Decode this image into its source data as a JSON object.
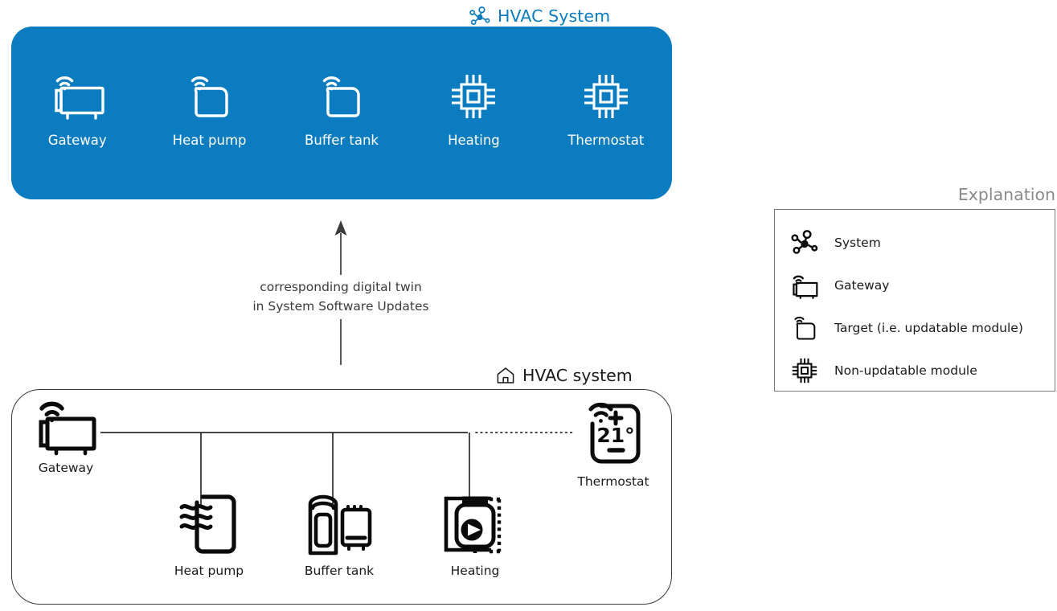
{
  "digital_twin": {
    "title": "HVAC System",
    "title_icon": "system-network-icon",
    "panel_color": "#0b7cbf",
    "title_color": "#0b7cbf",
    "nodes": [
      {
        "label": "Gateway",
        "icon": "gateway-icon"
      },
      {
        "label": "Heat pump",
        "icon": "target-module-icon"
      },
      {
        "label": "Buffer tank",
        "icon": "target-module-icon"
      },
      {
        "label": "Heating",
        "icon": "chip-icon"
      },
      {
        "label": "Thermostat",
        "icon": "chip-icon"
      }
    ]
  },
  "link": {
    "caption_line1": "corresponding digital twin",
    "caption_line2": "in System Software Updates",
    "arrow_direction": "up"
  },
  "physical_system": {
    "title": "HVAC system",
    "title_icon": "house-icon",
    "devices": [
      {
        "label": "Gateway",
        "icon": "gateway-icon"
      },
      {
        "label": "Heat pump",
        "icon": "heat-pump-icon"
      },
      {
        "label": "Buffer tank",
        "icon": "buffer-tank-icon"
      },
      {
        "label": "Heating",
        "icon": "heating-boiler-icon"
      },
      {
        "label": "Thermostat",
        "icon": "thermostat-icon"
      }
    ],
    "thermostat_reading": "21°",
    "thermostat_plus": "+",
    "thermostat_minus": "−",
    "wiring": {
      "solid_bus": "gateway to heating",
      "dotted_bus": "heating to thermostat"
    }
  },
  "legend": {
    "title": "Explanation",
    "title_color": "#8a8a8a",
    "items": [
      {
        "label": "System",
        "icon": "system-network-icon"
      },
      {
        "label": "Gateway",
        "icon": "gateway-icon"
      },
      {
        "label": "Target (i.e. updatable module)",
        "icon": "target-module-icon"
      },
      {
        "label": "Non-updatable module",
        "icon": "chip-icon"
      }
    ]
  }
}
